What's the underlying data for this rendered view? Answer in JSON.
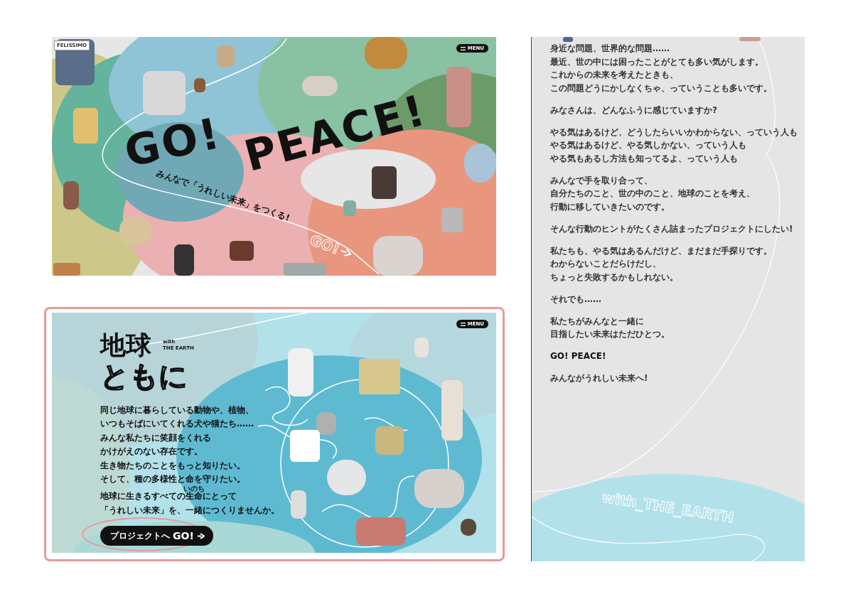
{
  "hero": {
    "logo": "FELISSIMO",
    "menu_button": "MENU",
    "title_words": [
      "GO!",
      "PEACE!"
    ],
    "subtitle": "みんなで「うれしい未来」をつくる!",
    "path_label": "GO!"
  },
  "earth_section": {
    "highlighted": true,
    "menu_button": "MENU",
    "title": "地球",
    "title_en_small": "with",
    "title_en": "THE EARTH",
    "title_outline": "ともに",
    "body_lines": [
      "同じ地球に暮らしている動物や、植物、",
      "いつもそばにいてくれる犬や猫たち……",
      "みんな私たちに笑顔をくれる",
      "かけがえのない存在です。",
      "生き物たちのことをもっと知りたい。",
      "そして、種の多様性と命を守りたい。",
      {
        "before": "地球に生きるすべての",
        "base": "生命",
        "ruby": "いのち",
        "after": "にとって"
      },
      "「うれしい未来」を、一緒につくりませんか。"
    ],
    "cta_button": {
      "label_prefix": "プロジェクトへ",
      "label_emphasis": "GO!"
    }
  },
  "message_column": {
    "paragraphs": [
      {
        "kind": "text",
        "lines": [
          "身近な問題、世界的な問題……",
          "最近、世の中には困ったことがとても多い気がします。",
          "これからの未来を考えたときも、",
          "この問題どうにかしなくちゃ、っていうことも多いです。"
        ]
      },
      {
        "kind": "text",
        "lines": [
          "みなさんは、どんなふうに感じていますか?"
        ]
      },
      {
        "kind": "text",
        "lines": [
          "やる気はあるけど、どうしたらいいかわからない、っていう人も",
          "やる気はあるけど、やる気しかない、っていう人も",
          "やる気もあるし方法も知ってるよ、っていう人も"
        ]
      },
      {
        "kind": "text",
        "lines": [
          "みんなで手を取り合って、",
          "自分たちのこと、世の中のこと、地球のことを考え、",
          "行動に移していきたいのです。"
        ]
      },
      {
        "kind": "text",
        "lines": [
          "そんな行動のヒントがたくさん詰まったプロジェクトにしたい!"
        ]
      },
      {
        "kind": "text",
        "lines": [
          "私たちも、やる気はあるんだけど、まだまだ手探りです。",
          "わからないことだらけだし、",
          "ちょっと失敗するかもしれない。"
        ]
      },
      {
        "kind": "text",
        "lines": [
          "それでも……"
        ]
      },
      {
        "kind": "text",
        "lines": [
          "私たちがみんなと一緒に",
          "目指したい未来はただひとつ。"
        ]
      },
      {
        "kind": "heading",
        "lines": [
          "GO! PEACE!"
        ]
      },
      {
        "kind": "text",
        "lines": [
          "みんながうれしい未来へ!"
        ]
      }
    ],
    "footer_label": "with_THE_EARTH"
  }
}
